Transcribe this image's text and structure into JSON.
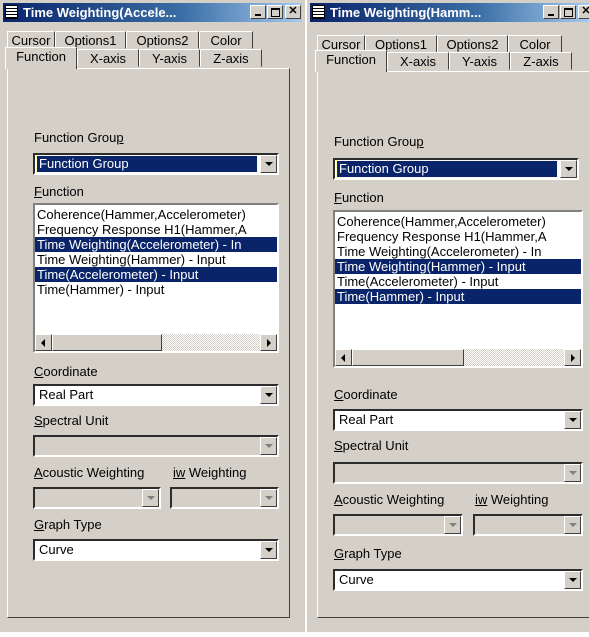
{
  "windows": [
    {
      "title": "Time Weighting(Accele...",
      "tabs_top": [
        "Cursor",
        "Options1",
        "Options2",
        "Color"
      ],
      "tabs_bottom": [
        "Function",
        "X-axis",
        "Y-axis",
        "Z-axis"
      ],
      "active_tab": "Function",
      "function_group_label": "Function Group",
      "function_group_value": "Function Group",
      "function_label": "Function",
      "function_items": [
        {
          "label": "Coherence(Hammer,Accelerometer)",
          "selected": false
        },
        {
          "label": "Frequency Response H1(Hammer,A",
          "selected": false
        },
        {
          "label": "Time Weighting(Accelerometer) - In",
          "selected": true
        },
        {
          "label": "Time Weighting(Hammer) - Input",
          "selected": false
        },
        {
          "label": "Time(Accelerometer) - Input",
          "selected": true
        },
        {
          "label": "Time(Hammer) - Input",
          "selected": false
        }
      ],
      "coordinate_label": "Coordinate",
      "coordinate_value": "Real Part",
      "spectral_unit_label": "Spectral Unit",
      "spectral_unit_value": "",
      "acoustic_weighting_label": "Acoustic Weighting",
      "iw_weighting_label": "iw Weighting",
      "acoustic_weighting_value": "",
      "iw_weighting_value": "",
      "graph_type_label": "Graph Type",
      "graph_type_value": "Curve"
    },
    {
      "title": "Time Weighting(Hamm...",
      "tabs_top": [
        "Cursor",
        "Options1",
        "Options2",
        "Color"
      ],
      "tabs_bottom": [
        "Function",
        "X-axis",
        "Y-axis",
        "Z-axis"
      ],
      "active_tab": "Function",
      "function_group_label": "Function Group",
      "function_group_value": "Function Group",
      "function_label": "Function",
      "function_items": [
        {
          "label": "Coherence(Hammer,Accelerometer)",
          "selected": false
        },
        {
          "label": "Frequency Response H1(Hammer,A",
          "selected": false
        },
        {
          "label": "Time Weighting(Accelerometer) - In",
          "selected": false
        },
        {
          "label": "Time Weighting(Hammer) - Input",
          "selected": true
        },
        {
          "label": "Time(Accelerometer) - Input",
          "selected": false
        },
        {
          "label": "Time(Hammer) - Input",
          "selected": true
        }
      ],
      "coordinate_label": "Coordinate",
      "coordinate_value": "Real Part",
      "spectral_unit_label": "Spectral Unit",
      "spectral_unit_value": "",
      "acoustic_weighting_label": "Acoustic Weighting",
      "iw_weighting_label": "iw Weighting",
      "acoustic_weighting_value": "",
      "iw_weighting_value": "",
      "graph_type_label": "Graph Type",
      "graph_type_value": "Curve"
    }
  ],
  "colors": {
    "selection": "#0a246a",
    "face": "#d4d0c8",
    "title_start": "#0a246a",
    "title_end": "#a6caf0"
  },
  "icons": [
    "window-system-icon",
    "minimize-icon",
    "maximize-icon",
    "close-icon",
    "dropdown-arrow-icon",
    "scroll-left-icon",
    "scroll-right-icon"
  ]
}
